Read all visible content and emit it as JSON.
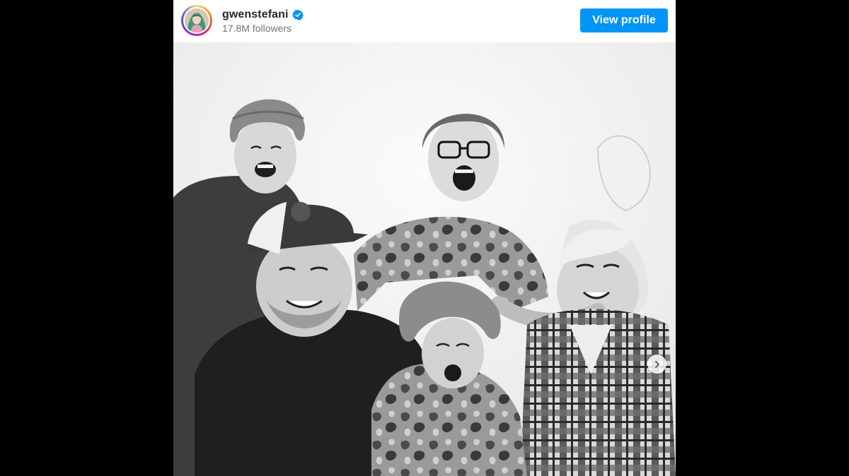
{
  "post": {
    "username": "gwenstefani",
    "followers": "17.8M followers",
    "verified": true,
    "view_profile_label": "View profile",
    "accent_color": "#0095f6",
    "photo_alt": "Black and white family photo",
    "icons": {
      "avatar": "profile-avatar",
      "verified": "verified-badge-icon",
      "next": "chevron-right-icon"
    }
  }
}
